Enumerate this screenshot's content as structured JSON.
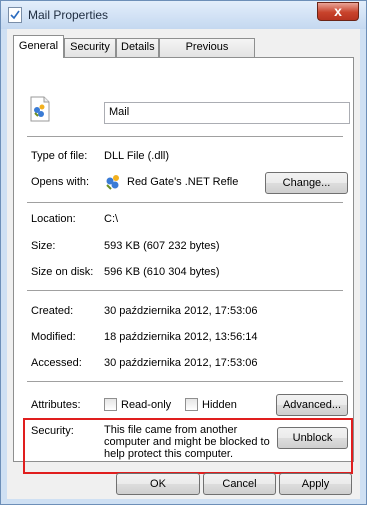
{
  "window": {
    "title": "Mail Properties",
    "close_glyph": "x"
  },
  "tabs": [
    {
      "label": "General",
      "active": true
    },
    {
      "label": "Security",
      "active": false
    },
    {
      "label": "Details",
      "active": false
    },
    {
      "label": "Previous Versions",
      "active": false
    }
  ],
  "file": {
    "name": "Mail"
  },
  "props": {
    "type_label": "Type of file:",
    "type_value": "DLL File (.dll)",
    "opens_label": "Opens with:",
    "opens_value": "Red Gate's .NET Reflec",
    "change_button": "Change...",
    "location_label": "Location:",
    "location_value": "C:\\",
    "size_label": "Size:",
    "size_value": "593 KB (607 232 bytes)",
    "size_disk_label": "Size on disk:",
    "size_disk_value": "596 KB (610 304 bytes)",
    "created_label": "Created:",
    "created_value": "30 października 2012, 17:53:06",
    "modified_label": "Modified:",
    "modified_value": "18 października 2012, 13:56:14",
    "accessed_label": "Accessed:",
    "accessed_value": "30 października 2012, 17:53:06",
    "attributes_label": "Attributes:",
    "readonly_label": "Read-only",
    "readonly_checked": false,
    "hidden_label": "Hidden",
    "hidden_checked": false,
    "advanced_button": "Advanced...",
    "security_label": "Security:",
    "security_line1": "This file came from another",
    "security_line2": "computer and might be blocked to",
    "security_line3": "help protect this computer.",
    "unblock_button": "Unblock"
  },
  "footer": {
    "ok_button": "OK",
    "cancel_button": "Cancel",
    "apply_button": "Apply"
  },
  "colors": {
    "highlight_border": "#e01e1e",
    "window_frame": "#cfe0f3"
  }
}
